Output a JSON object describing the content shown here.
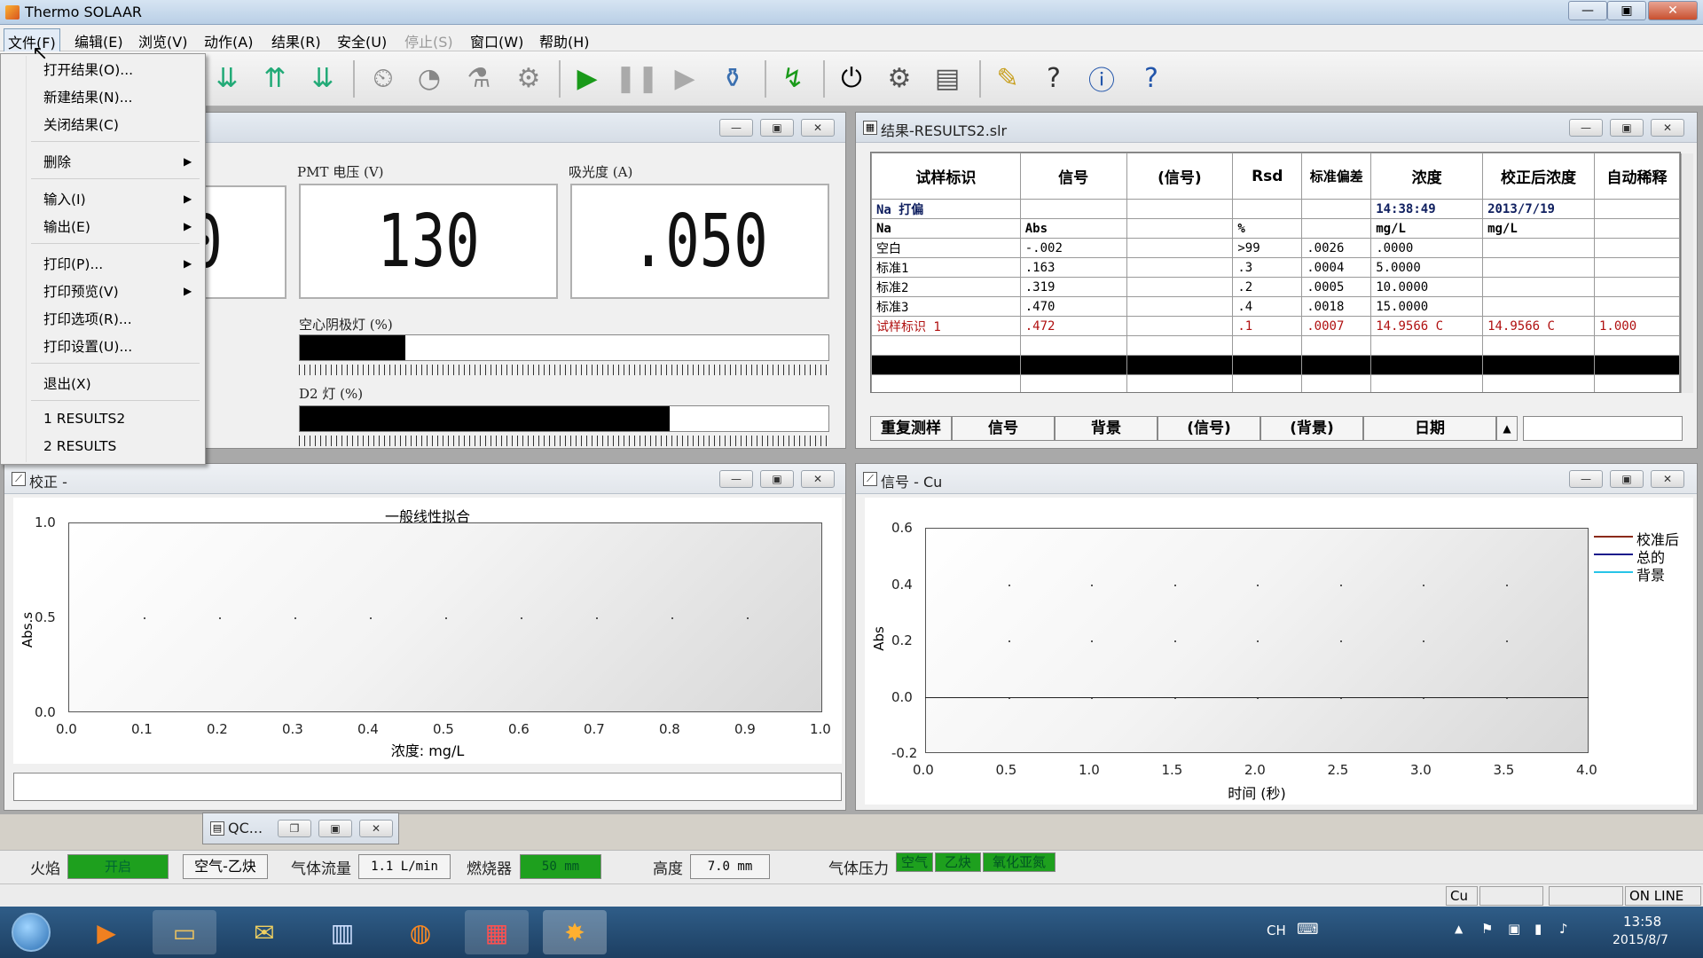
{
  "app": {
    "title": "Thermo SOLAAR"
  },
  "menubar": [
    {
      "label": "文件(F)",
      "state": "active"
    },
    {
      "label": "编辑(E)"
    },
    {
      "label": "浏览(V)"
    },
    {
      "label": "动作(A)"
    },
    {
      "label": "结果(R)"
    },
    {
      "label": "安全(U)"
    },
    {
      "label": "停止(S)",
      "state": "disabled"
    },
    {
      "label": "窗口(W)"
    },
    {
      "label": "帮助(H)"
    }
  ],
  "file_menu": [
    {
      "label": "打开结果(O)..."
    },
    {
      "label": "新建结果(N)..."
    },
    {
      "label": "关闭结果(C)"
    },
    {
      "label": "删除",
      "submenu": true
    },
    {
      "label": "输入(I)",
      "submenu": true
    },
    {
      "label": "输出(E)",
      "submenu": true
    },
    {
      "label": "打印(P)...",
      "submenu": true
    },
    {
      "label": "打印预览(V)",
      "submenu": true
    },
    {
      "label": "打印选项(R)..."
    },
    {
      "label": "打印设置(U)..."
    },
    {
      "label": "退出(X)"
    },
    {
      "label": "1 RESULTS2"
    },
    {
      "label": "2 RESULTS"
    }
  ],
  "instrument": {
    "left_value_partial": "0",
    "pmt_label": "PMT 电压 (V)",
    "pmt_value": "130",
    "abs_label": "吸光度 (A)",
    "abs_value": ".050",
    "hcl_label": "空心阴极灯 (%)",
    "hcl_percent": 20,
    "d2_label": "D2 灯 (%)",
    "d2_percent": 70
  },
  "results": {
    "title": "结果-RESULTS2.slr",
    "headers": [
      "试样标识",
      "信号",
      "(信号)",
      "Rsd",
      "标准偏差",
      "浓度",
      "校正后浓度",
      "自动稀释"
    ],
    "rows": [
      [
        "Na 打偏",
        "",
        "",
        "",
        "",
        "14:38:49",
        "2013/7/19",
        ""
      ],
      [
        "Na",
        "Abs",
        "",
        "%",
        "",
        "mg/L",
        "mg/L",
        ""
      ],
      [
        "空白",
        "-.002",
        "",
        ">99",
        ".0026",
        ".0000",
        "",
        ""
      ],
      [
        "标准1",
        ".163",
        "",
        ".3",
        ".0004",
        "5.0000",
        "",
        ""
      ],
      [
        "标准2",
        ".319",
        "",
        ".2",
        ".0005",
        "10.0000",
        "",
        ""
      ],
      [
        "标准3",
        ".470",
        "",
        ".4",
        ".0018",
        "15.0000",
        "",
        ""
      ],
      [
        "试样标识 1",
        ".472",
        "",
        ".1",
        ".0007",
        "14.9566 C",
        "14.9566 C",
        "1.000"
      ]
    ],
    "sub_headers": [
      "重复测样",
      "信号",
      "背景",
      "(信号)",
      "(背景)",
      "日期"
    ]
  },
  "calibration": {
    "window_title": "校正 -",
    "chart_data": {
      "type": "scatter",
      "title": "一般线性拟合",
      "xlabel": "浓度: mg/L",
      "ylabel": "Abs.s",
      "xlim": [
        0.0,
        1.0
      ],
      "ylim": [
        0.0,
        1.0
      ],
      "xticks": [
        "0.0",
        "0.1",
        "0.2",
        "0.3",
        "0.4",
        "0.5",
        "0.6",
        "0.7",
        "0.8",
        "0.9",
        "1.0"
      ],
      "yticks": [
        "1.0",
        "0.5",
        "0.0"
      ],
      "series": []
    }
  },
  "signal": {
    "window_title": "信号 - Cu",
    "chart_data": {
      "type": "line",
      "xlabel": "时间 (秒)",
      "ylabel": "Abs",
      "xlim": [
        0.0,
        4.0
      ],
      "ylim": [
        -0.2,
        0.6
      ],
      "xticks": [
        "0.0",
        "0.5",
        "1.0",
        "1.5",
        "2.0",
        "2.5",
        "3.0",
        "3.5",
        "4.0"
      ],
      "yticks": [
        "0.6",
        "0.4",
        "0.2",
        "0.0",
        "-0.2"
      ],
      "series": [
        {
          "name": "校准后",
          "color": "#8b2a1a",
          "values": []
        },
        {
          "name": "总的",
          "color": "#1a1a8b",
          "values": []
        },
        {
          "name": "背景",
          "color": "#27c4e8",
          "values": []
        }
      ]
    }
  },
  "qc_window": {
    "title": "QC..."
  },
  "status": {
    "flame_label": "火焰",
    "flame_value": "开启",
    "gas_value": "空气-乙炔",
    "flow_label": "气体流量",
    "flow_value": "1.1 L/min",
    "burner_label": "燃烧器",
    "burner_value": "50 mm",
    "height_label": "高度",
    "height_value": "7.0 mm",
    "pressure_label": "气体压力",
    "pressure_items": [
      "空气",
      "乙炔",
      "氧化亚氮"
    ],
    "element": "Cu",
    "online": "ON LINE"
  },
  "taskbar": {
    "lang": "CH",
    "time": "13:58",
    "date": "2015/8/7"
  }
}
